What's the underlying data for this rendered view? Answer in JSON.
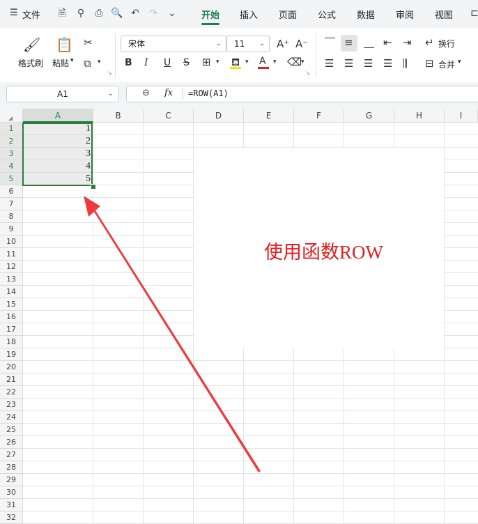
{
  "menubar": {
    "file_label": "文件",
    "tabs": [
      {
        "label": "开始",
        "active": true
      },
      {
        "label": "插入"
      },
      {
        "label": "页面"
      },
      {
        "label": "公式"
      },
      {
        "label": "数据"
      },
      {
        "label": "审阅"
      },
      {
        "label": "视图"
      }
    ],
    "accent": "#1a7f4b"
  },
  "ribbon": {
    "format_painter": "格式刷",
    "paste": "粘贴",
    "font_name": "宋体",
    "font_size": "11",
    "wrap": "换行",
    "merge": "合并",
    "bold": "B",
    "italic": "I",
    "underline": "U",
    "strike": "S"
  },
  "formula_bar": {
    "cell_ref": "A1",
    "fx": "fx",
    "formula": "=ROW(A1)"
  },
  "sheet": {
    "columns": [
      "A",
      "B",
      "C",
      "D",
      "E",
      "F",
      "G",
      "H",
      "I"
    ],
    "rows": [
      "1",
      "2",
      "3",
      "4",
      "5",
      "6",
      "7",
      "8",
      "9",
      "10",
      "11",
      "12",
      "13",
      "14",
      "15",
      "16",
      "17",
      "18",
      "19",
      "20",
      "21",
      "22",
      "23",
      "24",
      "25",
      "26",
      "27",
      "28",
      "29",
      "30",
      "31",
      "32"
    ],
    "values": [
      "1",
      "2",
      "3",
      "4",
      "5"
    ],
    "selection_color": "#2e7d32"
  },
  "annotation": {
    "text": "使用函数ROW",
    "color": "#e02020"
  }
}
